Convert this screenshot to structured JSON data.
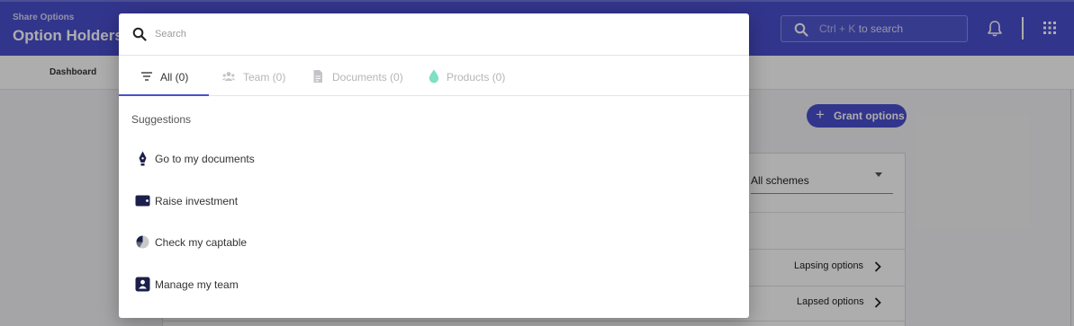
{
  "header": {
    "subtitle": "Share Options",
    "title": "Option Holders",
    "search_hint_kbd": "Ctrl + K",
    "search_hint_text": "to search"
  },
  "subnav": {
    "items": [
      {
        "label": "Dashboard"
      }
    ]
  },
  "main": {
    "grant_button_label": "Grant options",
    "scheme_filter_value": "All schemes",
    "rows": [
      {
        "label": "Lapsing options"
      },
      {
        "label": "Lapsed options"
      }
    ]
  },
  "search_modal": {
    "placeholder": "Search",
    "tabs": [
      {
        "label": "All (0)",
        "icon": "filter-lines-icon",
        "active": true
      },
      {
        "label": "Team (0)",
        "icon": "people-icon",
        "active": false
      },
      {
        "label": "Documents (0)",
        "icon": "document-icon",
        "active": false
      },
      {
        "label": "Products (0)",
        "icon": "droplet-icon",
        "active": false
      }
    ],
    "suggestions_title": "Suggestions",
    "suggestions": [
      {
        "label": "Go to my documents",
        "icon": "pen-nib-icon"
      },
      {
        "label": "Raise investment",
        "icon": "wallet-icon"
      },
      {
        "label": "Check my captable",
        "icon": "pie-chart-icon"
      },
      {
        "label": "Manage my team",
        "icon": "person-badge-icon"
      }
    ]
  },
  "colors": {
    "brand": "#4a4fce",
    "tab_indicator": "#4a4fce",
    "products_icon": "#7fe0c4",
    "icon_dark": "#1c1f4a"
  }
}
